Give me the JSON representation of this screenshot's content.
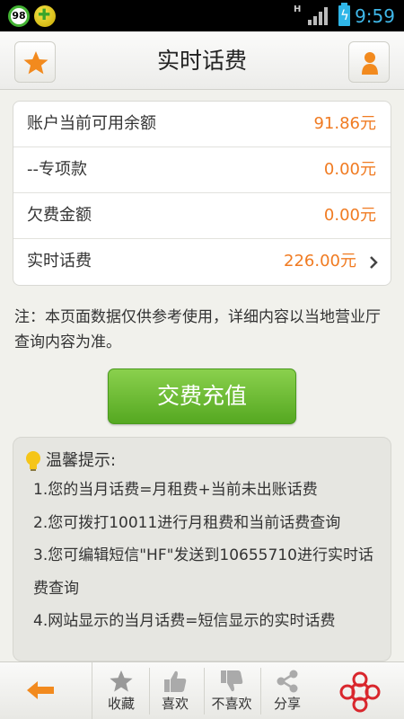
{
  "status_bar": {
    "notification_badge": "98",
    "network_type": "H",
    "time": "9:59"
  },
  "header": {
    "title": "实时话费"
  },
  "balance": {
    "rows": [
      {
        "label": "账户当前可用余额",
        "value": "91.86元"
      },
      {
        "label": "--专项款",
        "value": "0.00元"
      },
      {
        "label": "欠费金额",
        "value": "0.00元"
      },
      {
        "label": "实时话费",
        "value": "226.00元"
      }
    ]
  },
  "note": "注：本页面数据仅供参考使用，详细内容以当地营业厅查询内容为准。",
  "recharge_button": "交费充值",
  "tips": {
    "title": "温馨提示:",
    "items": [
      "1.您的当月话费=月租费+当前未出账话费",
      "2.您可拨打10011进行月租费和当前话费查询",
      "3.您可编辑短信\"HF\"发送到10655710进行实时话费查询",
      "4.网站显示的当月话费=短信显示的实时话费"
    ]
  },
  "bottom_bar": {
    "favorite": "收藏",
    "like": "喜欢",
    "dislike": "不喜欢",
    "share": "分享"
  },
  "colors": {
    "accent_orange": "#f07b22",
    "button_green": "#6abd35",
    "status_time": "#3fb7e8"
  },
  "icons": [
    "star-icon",
    "person-icon",
    "chevron-right-icon",
    "lightbulb-icon",
    "back-arrow-icon",
    "thumbs-up-icon",
    "thumbs-down-icon",
    "share-icon",
    "china-unicom-logo"
  ]
}
